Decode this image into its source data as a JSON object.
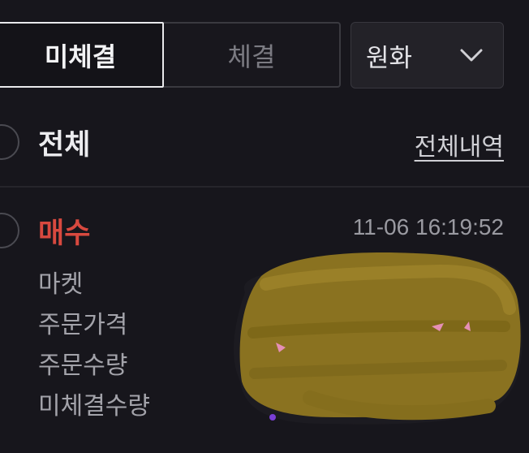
{
  "tabs": {
    "unfilled_label": "미체결",
    "filled_label": "체결",
    "active": "unfilled"
  },
  "currency_select": {
    "value": "원화",
    "icon": "chevron-down-icon"
  },
  "all_row": {
    "label": "전체",
    "history_link": "전체내역"
  },
  "order": {
    "side": "매수",
    "time": "11-06 16:19:52",
    "field_labels": [
      "마켓",
      "주문가격",
      "주문수량",
      "미체결수량"
    ]
  },
  "colors": {
    "background": "#17161c",
    "buy": "#d8493f",
    "redaction": "#8a7220"
  }
}
